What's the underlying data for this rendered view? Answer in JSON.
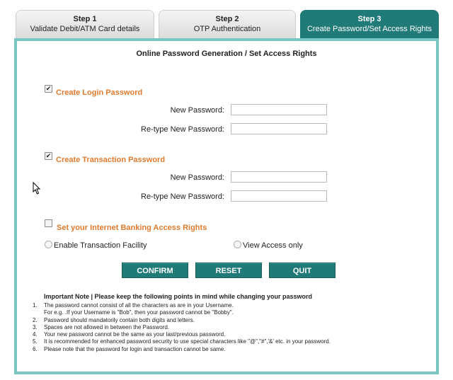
{
  "steps": [
    {
      "title": "Step 1",
      "subtitle": "Validate Debit/ATM Card details"
    },
    {
      "title": "Step 2",
      "subtitle": "OTP Authentication"
    },
    {
      "title": "Step 3",
      "subtitle": "Create Password/Set Access Rights"
    }
  ],
  "page_title": "Online Password Generation / Set Access Rights",
  "login_section": {
    "label": "Create Login Password",
    "checked": true,
    "new_password_label": "New Password:",
    "retype_label": "Re-type New Password:",
    "new_password_value": "",
    "retype_value": ""
  },
  "transaction_section": {
    "label": "Create Transaction Password",
    "checked": true,
    "new_password_label": "New Password:",
    "retype_label": "Re-type New Password:",
    "new_password_value": "",
    "retype_value": ""
  },
  "access_section": {
    "label": "Set your Internet Banking Access Rights",
    "checked": false,
    "options": [
      "Enable Transaction Facility",
      "View Access only"
    ]
  },
  "buttons": {
    "confirm": "CONFIRM",
    "reset": "RESET",
    "quit": "QUIT"
  },
  "note_title": "Important Note | Please keep the following points in mind while changing your password",
  "notes": [
    {
      "num": "1.",
      "text": "The password cannot consist of all the characters as are in your Username.",
      "sub": "For e.g. .If your Username is \"Bob\", then your password cannot be \"Bobby\"."
    },
    {
      "num": "2.",
      "text": "Password should mandatorily contain both digits and letters."
    },
    {
      "num": "3.",
      "text": "Spaces are not allowed in between the Password."
    },
    {
      "num": "4.",
      "text": "Your new password cannot be the same as your last/previous password."
    },
    {
      "num": "5.",
      "text": "It is recommended for enhanced password security to use special characters like \"@\",\"#\",'&' etc. in your password."
    },
    {
      "num": "6.",
      "text": "Please note that the password for login and transaction cannot be same."
    }
  ],
  "colors": {
    "accent": "#1f7a78",
    "panel_border": "#79c6c2",
    "section_label": "#e07b2e"
  }
}
